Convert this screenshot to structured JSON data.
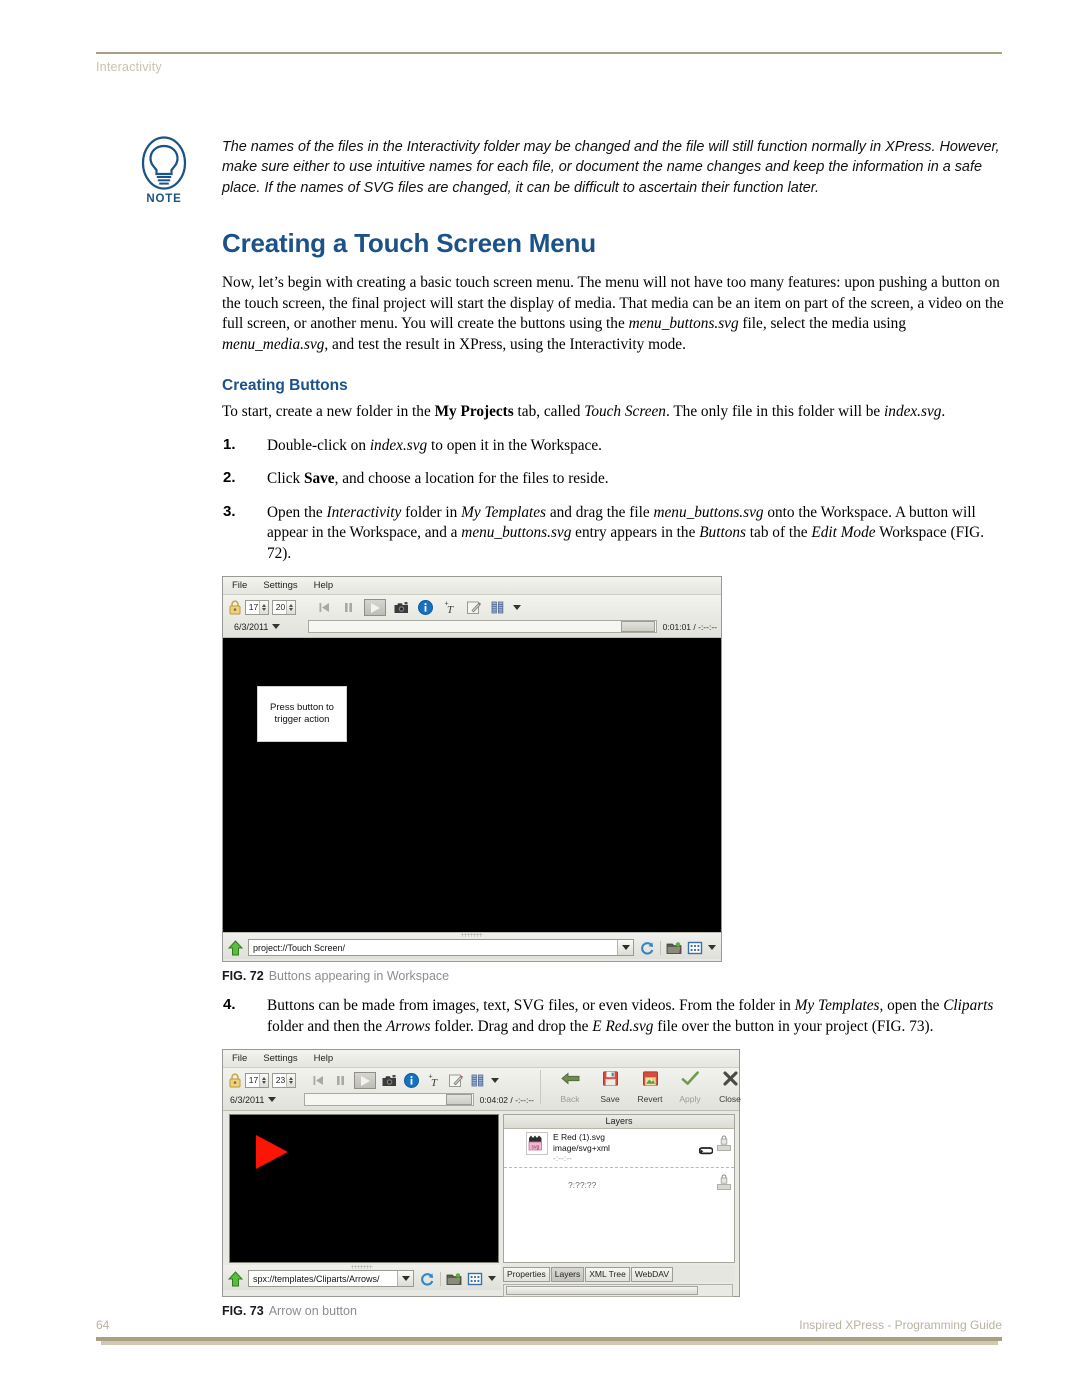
{
  "header": {
    "label": "Interactivity"
  },
  "note": {
    "icon": "lightbulb-icon",
    "word": "NOTE",
    "text": "The names of the files in the Interactivity folder may be changed and the file will still function normally in XPress. However, make sure either to use intuitive names for each file, or document the name changes and keep the information in a safe place. If the names of SVG files are changed, it can be difficult to ascertain their function later."
  },
  "main": {
    "section_title": "Creating a Touch Screen Menu",
    "intro_paragraph": "Now, let’s begin with creating a basic touch screen menu. The menu will not have too many features: upon pushing a button on the touch screen, the final project will start the display of media. That media can be an item on part of the screen, a video on the full screen, or another menu. You will create the buttons using the menu_buttons.svg file, select the media using menu_media.svg, and test the result in XPress, using the Interactivity mode.",
    "sub_title": "Creating Buttons",
    "sub_intro": "To start, create a new folder in the My Projects tab, called Touch Screen. The only file in this folder will be index.svg.",
    "steps": [
      {
        "num": "1.",
        "text": "Double-click on index.svg to open it in the Workspace."
      },
      {
        "num": "2.",
        "text": "Click Save, and choose a location for the files to reside."
      },
      {
        "num": "3.",
        "text": "Open the Interactivity folder in My Templates and drag the file menu_buttons.svg onto the Workspace. A button will appear in the Workspace, and a menu_buttons.svg entry appears in the Buttons tab of the Edit Mode Workspace (FIG. 72)."
      },
      {
        "num": "4.",
        "text": "Buttons can be made from images, text, SVG files, or even videos. From the folder in My Templates, open the Cliparts folder and then the Arrows folder. Drag and drop the E Red.svg file over the button in your project (FIG. 73)."
      }
    ]
  },
  "fig72": {
    "caption_num": "FIG. 72",
    "caption_text": "Buttons appearing in Workspace",
    "menu": [
      "File",
      "Settings",
      "Help"
    ],
    "spinner_a": "17",
    "spinner_b": "20",
    "date": "6/3/2011",
    "time": "0:01:01 / -:--:--",
    "icons": [
      "lock-icon",
      "skip-back-icon",
      "pause-icon",
      "play-icon",
      "camera-icon",
      "info-icon",
      "add-text-icon",
      "edit-icon",
      "columns-icon",
      "chevron-down-icon"
    ],
    "button_label": "Press button to trigger action",
    "path": "project://Touch Screen/",
    "path_icons": [
      "up-arrow-icon",
      "chevron-down-icon",
      "refresh-icon",
      "folder-icon",
      "grid-icon",
      "chevron-down-icon"
    ]
  },
  "fig73": {
    "caption_num": "FIG. 73",
    "caption_text": "Arrow on button",
    "menu": [
      "File",
      "Settings",
      "Help"
    ],
    "spinner_a": "17",
    "spinner_b": "23",
    "date": "6/3/2011",
    "time": "0:04:02 / -:--:--",
    "actions": [
      {
        "label": "Back",
        "icon": "back-arrow-icon"
      },
      {
        "label": "Save",
        "icon": "floppy-disk-icon"
      },
      {
        "label": "Revert",
        "icon": "revert-icon"
      },
      {
        "label": "Apply",
        "icon": "check-icon"
      },
      {
        "label": "Close",
        "icon": "close-x-icon"
      }
    ],
    "layers_title": "Layers",
    "layer_name": "E Red (1).svg",
    "layer_type": "image/svg+xml",
    "layer_time": "-:--:--",
    "layer_unknown_time": "?:??:??",
    "tabs": [
      "Properties",
      "Layers",
      "XML Tree",
      "WebDAV"
    ],
    "active_tab": "Layers",
    "path": "spx://templates/Cliparts/Arrows/",
    "arrow_color": "#fa1505"
  },
  "footer": {
    "page_number": "64",
    "guide_title": "Inspired XPress - Programming Guide"
  },
  "colors": {
    "heading_blue": "#1b5288",
    "rule_olive": "#a8a081",
    "header_text": "#c9c3ad"
  }
}
